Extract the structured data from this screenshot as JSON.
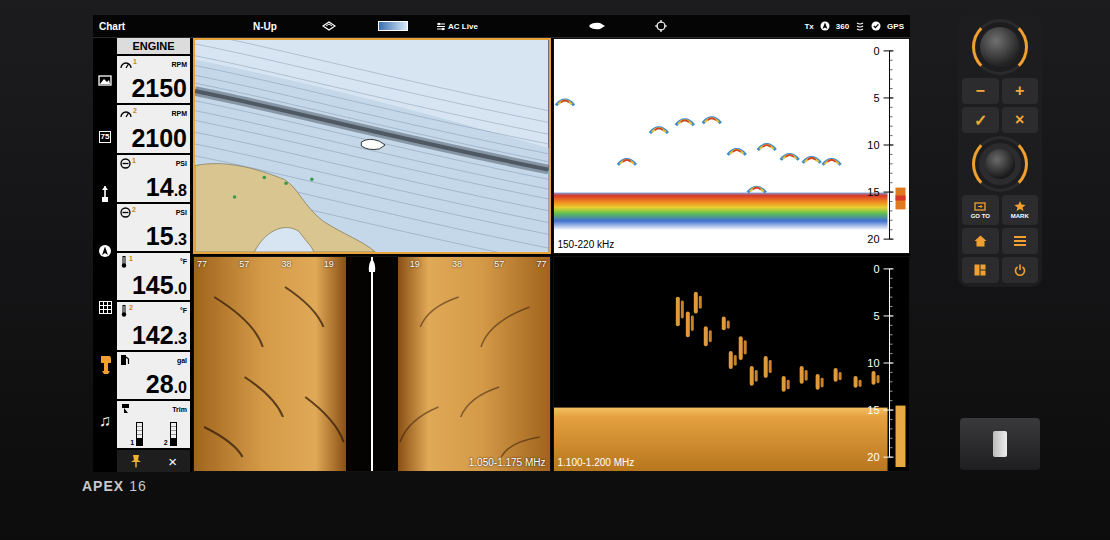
{
  "device": {
    "brand": "APEX",
    "size": "16"
  },
  "topbar": {
    "title": "Chart",
    "orientation": "N-Up",
    "overlay": "AC Live",
    "status": [
      {
        "kind": "text",
        "label": "Tx"
      },
      {
        "kind": "compass"
      },
      {
        "kind": "text",
        "label": "360"
      },
      {
        "kind": "sonar"
      },
      {
        "kind": "check"
      },
      {
        "kind": "text",
        "label": "GPS"
      }
    ]
  },
  "rail": [
    {
      "kind": "photo",
      "selected": false
    },
    {
      "kind": "speed",
      "label": "75",
      "selected": false
    },
    {
      "kind": "trolling",
      "selected": false
    },
    {
      "kind": "compass",
      "selected": false
    },
    {
      "kind": "grid",
      "selected": false
    },
    {
      "kind": "engine",
      "selected": true
    },
    {
      "kind": "music",
      "label": "♫",
      "selected": false
    }
  ],
  "engine": {
    "title": "ENGINE",
    "close": "×",
    "gauges": [
      {
        "kind": "value",
        "icon": "tach",
        "index": "1",
        "unit": "RPM",
        "whole": "2150",
        "fraction": ""
      },
      {
        "kind": "value",
        "icon": "tach",
        "index": "2",
        "unit": "RPM",
        "whole": "2100",
        "fraction": ""
      },
      {
        "kind": "value",
        "icon": "pressure",
        "index": "1",
        "unit": "PSI",
        "whole": "14",
        "fraction": ".8"
      },
      {
        "kind": "value",
        "icon": "pressure",
        "index": "2",
        "unit": "PSI",
        "whole": "15",
        "fraction": ".3"
      },
      {
        "kind": "value",
        "icon": "temp",
        "index": "1",
        "unit": "°F",
        "whole": "145",
        "fraction": ".0"
      },
      {
        "kind": "value",
        "icon": "temp",
        "index": "2",
        "unit": "°F",
        "whole": "142",
        "fraction": ".3"
      },
      {
        "kind": "value",
        "icon": "fuel",
        "unit": "gal",
        "whole": "28",
        "fraction": ".0"
      },
      {
        "kind": "trim",
        "icon": "trim",
        "unit": "Trim",
        "gauges": [
          {
            "index": "1",
            "level": 0.3
          },
          {
            "index": "2",
            "level": 0.3
          }
        ]
      }
    ]
  },
  "panes": [
    {
      "kind": "chart",
      "selected": true
    },
    {
      "kind": "sonar",
      "selected": false,
      "frequency": "150-220 kHz",
      "depth_ticks": [
        "0",
        "5",
        "10",
        "15",
        "20"
      ]
    },
    {
      "kind": "side",
      "selected": false,
      "frequency": "1.050-1.175 MHz",
      "range_left": [
        "77",
        "57",
        "38",
        "19"
      ],
      "range_right": [
        "19",
        "38",
        "57",
        "77"
      ]
    },
    {
      "kind": "down",
      "selected": false,
      "frequency": "1.100-1.200 MHz",
      "depth_ticks": [
        "0",
        "5",
        "10",
        "15",
        "20"
      ]
    }
  ],
  "controls": {
    "minus": "−",
    "plus": "+",
    "confirm": "✓",
    "cancel": "×",
    "goto": "GO TO",
    "mark": "MARK"
  }
}
